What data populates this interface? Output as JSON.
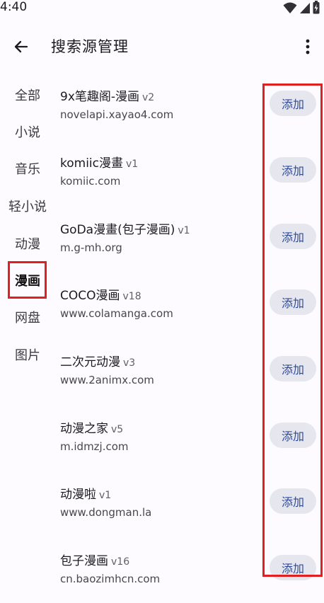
{
  "status_bar": {
    "time": "4:40",
    "icons": [
      "wifi-icon",
      "signal-icon",
      "battery-charging-icon"
    ]
  },
  "app_bar": {
    "back_icon": "arrow-left-icon",
    "title": "搜索源管理",
    "more_icon": "more-vertical-icon"
  },
  "sidebar": {
    "items": [
      {
        "label": "全部"
      },
      {
        "label": "小说"
      },
      {
        "label": "音乐"
      },
      {
        "label": "轻小说"
      },
      {
        "label": "动漫"
      },
      {
        "label": "漫画"
      },
      {
        "label": "网盘"
      },
      {
        "label": "图片"
      }
    ],
    "selected": "漫画"
  },
  "sources": [
    {
      "name": "9x笔趣阁-漫画",
      "version": "v2",
      "url": "novelapi.xayao4.com",
      "action": "添加"
    },
    {
      "name": "komiic漫畫",
      "version": "v1",
      "url": "komiic.com",
      "action": "添加"
    },
    {
      "name": "GoDa漫畫(包子漫画)",
      "version": "v1",
      "url": "m.g-mh.org",
      "action": "添加"
    },
    {
      "name": "COCO漫画",
      "version": "v18",
      "url": "www.colamanga.com",
      "action": "添加"
    },
    {
      "name": "二次元动漫",
      "version": "v3",
      "url": "www.2animx.com",
      "action": "添加"
    },
    {
      "name": "动漫之家",
      "version": "v5",
      "url": "m.idmzj.com",
      "action": "添加"
    },
    {
      "name": "动漫啦",
      "version": "v1",
      "url": "www.dongman.la",
      "action": "添加"
    },
    {
      "name": "包子漫画",
      "version": "v16",
      "url": "cn.baozimhcn.com",
      "action": "添加"
    }
  ],
  "colors": {
    "background": "#fdfbff",
    "button_bg": "#e6e6ee",
    "button_text": "#2c4a9c",
    "highlight": "#e02020"
  }
}
